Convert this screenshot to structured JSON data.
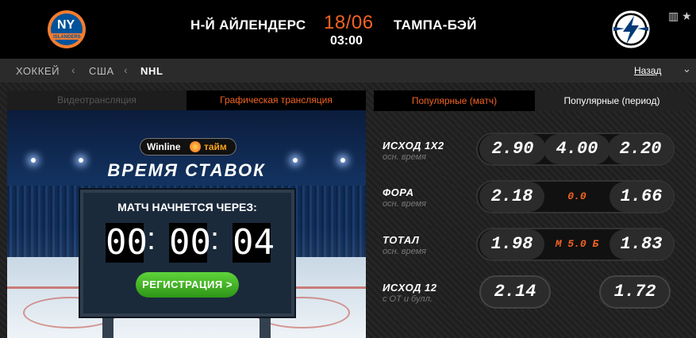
{
  "header": {
    "home_team": "Н-Й АЙЛЕНДЕРС",
    "away_team": "ТАМПА-БЭЙ",
    "date": "18/06",
    "time": "03:00",
    "home_logo_text": "NY",
    "home_logo_sub": "ISLANDERS"
  },
  "breadcrumb": {
    "items": [
      "ХОККЕЙ",
      "США",
      "NHL"
    ],
    "back_label": "Назад"
  },
  "broadcast": {
    "tabs": [
      "Видеотрансляция",
      "Графическая трансляция"
    ],
    "brand_part1": "Winline",
    "brand_part2": "тайм",
    "headline": "ВРЕМЯ СТАВОК",
    "board_title": "МАТЧ НАЧНЕТСЯ ЧЕРЕЗ:",
    "digits": [
      "00",
      "00",
      "04"
    ],
    "register_label": "РЕГИСТРАЦИЯ >"
  },
  "markets": {
    "tabs": [
      "Популярные (матч)",
      "Популярные (период)"
    ],
    "rows": [
      {
        "name": "ИСХОД 1Х2",
        "sub": "осн. время",
        "odds": [
          "2.90",
          "4.00",
          "2.20"
        ]
      },
      {
        "name": "ФОРА",
        "sub": "осн. время",
        "odds": [
          "2.18",
          "0.0",
          "1.66"
        ]
      },
      {
        "name": "ТОТАЛ",
        "sub": "осн. время",
        "odds": [
          "1.98",
          "М 5.0 Б",
          "1.83"
        ]
      },
      {
        "name": "ИСХОД 12",
        "sub": "с ОТ и булл.",
        "odds": [
          "2.14",
          "1.72"
        ]
      }
    ]
  },
  "colors": {
    "accent": "#f26322",
    "register": "#3bb521"
  }
}
